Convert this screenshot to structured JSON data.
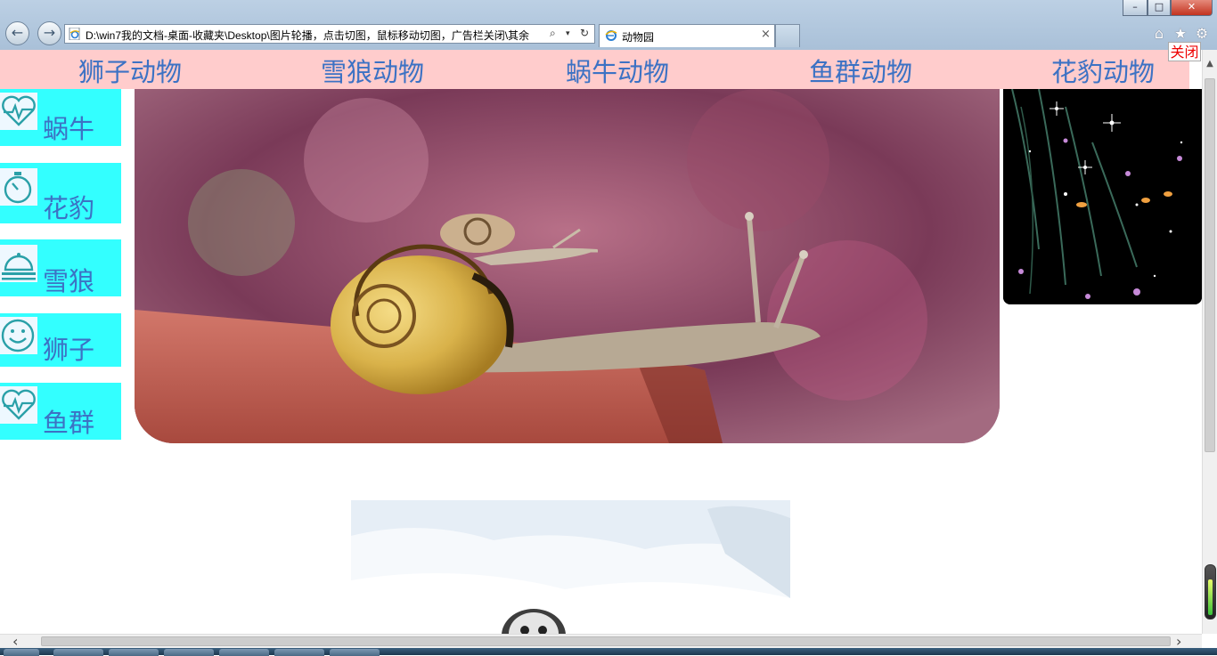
{
  "browser": {
    "address": "D:\\win7我的文档-桌面-收藏夹\\Desktop\\图片轮播，点击切图，鼠标移动切图，广告栏关闭\\其余",
    "tab_title": "动物园",
    "tab_close": "×",
    "minimize": "–",
    "maximize": "□",
    "close": "✕",
    "back": "←",
    "forward": "→",
    "search_glyph": "⌕",
    "dropdown_glyph": "▾",
    "refresh_glyph": "↻",
    "home_glyph": "⌂",
    "favorites_glyph": "★",
    "tools_glyph": "⚙"
  },
  "top_nav": {
    "items": [
      {
        "label": "狮子动物"
      },
      {
        "label": "雪狼动物"
      },
      {
        "label": "蜗牛动物"
      },
      {
        "label": "鱼群动物"
      },
      {
        "label": "花豹动物"
      }
    ]
  },
  "sidebar": {
    "items": [
      {
        "label": "蜗牛",
        "icon": "heartbeat-icon"
      },
      {
        "label": "花豹",
        "icon": "stopwatch-icon"
      },
      {
        "label": "雪狼",
        "icon": "service-bell-icon"
      },
      {
        "label": "狮子",
        "icon": "smiley-icon"
      },
      {
        "label": "鱼群",
        "icon": "heartbeat-icon"
      }
    ]
  },
  "ad": {
    "close_label": "关闭"
  },
  "scroll": {
    "left_glyph": "‹",
    "right_glyph": "›",
    "up_glyph": "▲"
  },
  "colors": {
    "nav_bg": "#ffcccc",
    "sidebar_bg": "#33ffff",
    "link_text": "#3c72c4",
    "ad_close_text": "#ee0000"
  }
}
